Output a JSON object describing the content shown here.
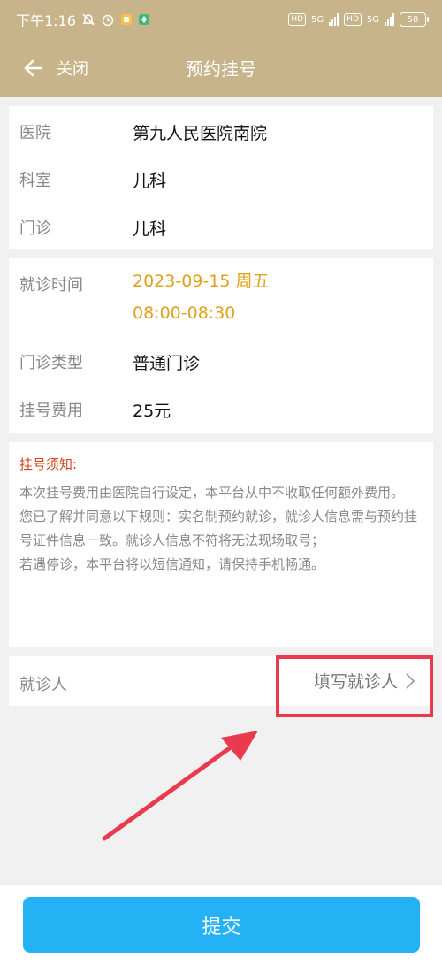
{
  "status_bar": {
    "time": "下午1:16",
    "hd1": "HD",
    "net1": "5G",
    "hd2": "HD",
    "net2": "5G",
    "battery": "58"
  },
  "nav": {
    "close_label": "关闭",
    "title": "预约挂号"
  },
  "info": {
    "hospital_label": "医院",
    "hospital_value": "第九人民医院南院",
    "department_label": "科室",
    "department_value": "儿科",
    "clinic_label": "门诊",
    "clinic_value": "儿科"
  },
  "appointment": {
    "time_label": "就诊时间",
    "date_value": "2023-09-15  周五",
    "time_value": "08:00-08:30",
    "type_label": "门诊类型",
    "type_value": "普通门诊",
    "fee_label": "挂号费用",
    "fee_value": "25元"
  },
  "notice": {
    "title": "挂号须知:",
    "line1": "本次挂号费用由医院自行设定，本平台从中不收取任何额外费用。",
    "line2": "您已了解并同意以下规则：实名制预约就诊，就诊人信息需与预约挂号证件信息一致。就诊人信息不符将无法现场取号；",
    "line3": "若遇停诊，本平台将以短信通知，请保持手机畅通。"
  },
  "patient": {
    "label": "就诊人",
    "action": "填写就诊人"
  },
  "footer": {
    "submit_label": "提交"
  }
}
